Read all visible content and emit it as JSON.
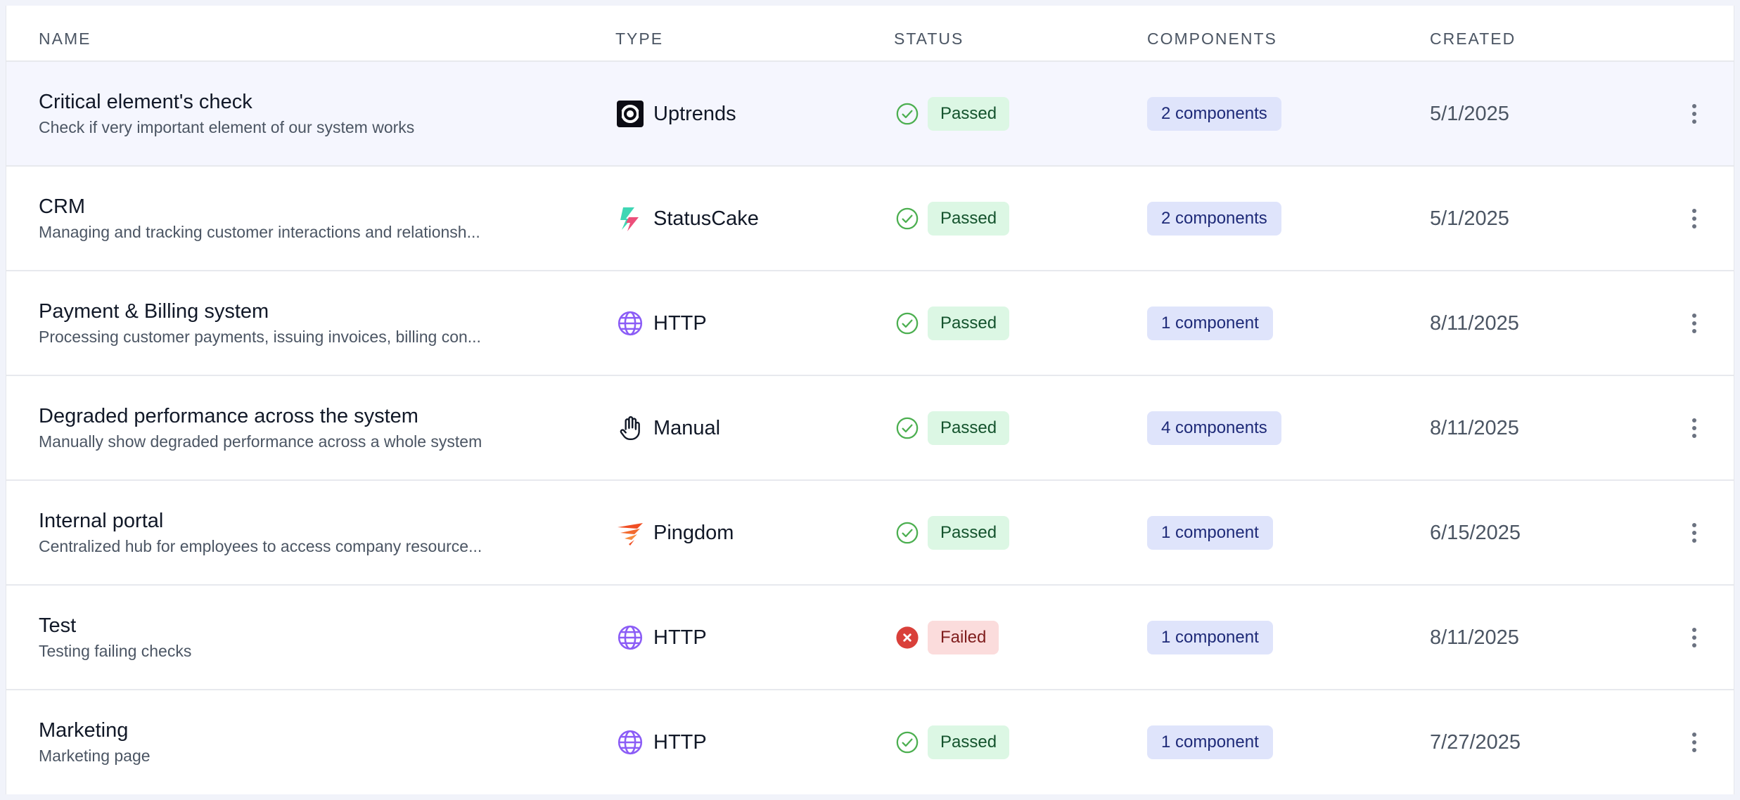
{
  "table": {
    "headers": {
      "name": "NAME",
      "type": "TYPE",
      "status": "STATUS",
      "components": "COMPONENTS",
      "created": "CREATED"
    },
    "rows": [
      {
        "name": "Critical element's check",
        "description": "Check if very important element of our system works",
        "type": "Uptrends",
        "type_icon": "uptrends-icon",
        "status": "Passed",
        "components": "2 components",
        "created": "5/1/2025"
      },
      {
        "name": "CRM",
        "description": "Managing and tracking customer interactions and relationsh...",
        "type": "StatusCake",
        "type_icon": "statuscake-icon",
        "status": "Passed",
        "components": "2 components",
        "created": "5/1/2025"
      },
      {
        "name": "Payment & Billing system",
        "description": "Processing customer payments, issuing invoices, billing con...",
        "type": "HTTP",
        "type_icon": "globe-icon",
        "status": "Passed",
        "components": "1 component",
        "created": "8/11/2025"
      },
      {
        "name": "Degraded performance across the system",
        "description": "Manually show degraded performance across a whole system",
        "type": "Manual",
        "type_icon": "hand-icon",
        "status": "Passed",
        "components": "4 components",
        "created": "8/11/2025"
      },
      {
        "name": "Internal portal",
        "description": "Centralized hub for employees to access company resource...",
        "type": "Pingdom",
        "type_icon": "pingdom-icon",
        "status": "Passed",
        "components": "1 component",
        "created": "6/15/2025"
      },
      {
        "name": "Test",
        "description": "Testing failing checks",
        "type": "HTTP",
        "type_icon": "globe-icon",
        "status": "Failed",
        "components": "1 component",
        "created": "8/11/2025"
      },
      {
        "name": "Marketing",
        "description": "Marketing page",
        "type": "HTTP",
        "type_icon": "globe-icon",
        "status": "Passed",
        "components": "1 component",
        "created": "7/27/2025"
      }
    ]
  },
  "colors": {
    "passed_icon": "#4caf50",
    "failed_icon": "#d9403a",
    "http_icon": "#8b5cf6",
    "row_highlight": "#f5f6fe"
  }
}
